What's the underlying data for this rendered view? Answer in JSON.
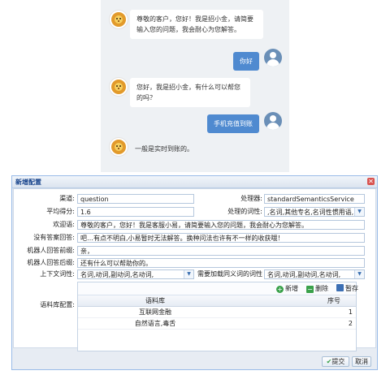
{
  "chat": {
    "messages": [
      {
        "from": "bot",
        "text": "尊敬的客户，您好！我是招小金，请简要输入您的问题，我会耐心为您解答。"
      },
      {
        "from": "user",
        "text": "你好"
      },
      {
        "from": "bot",
        "text": "您好，我是招小金，有什么可以帮您的吗？"
      },
      {
        "from": "user",
        "text": "手机充值到账"
      },
      {
        "from": "bot",
        "text": "一般是实时到账的。"
      }
    ]
  },
  "dialog": {
    "title": "新增配置",
    "close_icon": "close-icon",
    "form": {
      "channel": {
        "label": "渠道:",
        "value": "question"
      },
      "processor": {
        "label": "处理器:",
        "value": "standardSemanticsService"
      },
      "avg_score": {
        "label": "平均得分:",
        "value": "1.6"
      },
      "pos_tags": {
        "label": "处理的词性:",
        "value": ",名词,其他专名,名词性惯用语,"
      },
      "welcome": {
        "label": "欢迎语:",
        "value": "尊敬的客户，您好！我是客服小易，请简要输入您的问题，我会耐心为您解答。"
      },
      "no_answer": {
        "label": "没有答案回答:",
        "value": "吧…有点不明白,小易暂时无法解答。换种问法也许有不一样的收获哦！"
      },
      "robot_prefix": {
        "label": "机器人回答前缀:",
        "value": "亲，"
      },
      "robot_suffix": {
        "label": "机器人回答后缀:",
        "value": "还有什么可以帮助你的。"
      },
      "context_pos": {
        "label": "上下文词性:",
        "value": "名词,动词,副动词,名动词,"
      },
      "synonym_pos": {
        "label": "需要加载同义词的词性",
        "value": "名词,动词,副动词,名动词,"
      },
      "corpus_label": "语料库配置:"
    },
    "corpus_grid": {
      "toolbar": {
        "add": "新增",
        "delete": "删除",
        "save": "暂存"
      },
      "columns": [
        "语料库",
        "序号"
      ],
      "rows": [
        {
          "name": "互联网金融",
          "seq": "1"
        },
        {
          "name": "自然语言,毒舌",
          "seq": "2"
        }
      ]
    },
    "footer": {
      "submit": "提交",
      "cancel": "取消"
    }
  },
  "colors": {
    "accent": "#4f8ad0",
    "dialog_border": "#99bbe8",
    "title": "#15428b"
  }
}
